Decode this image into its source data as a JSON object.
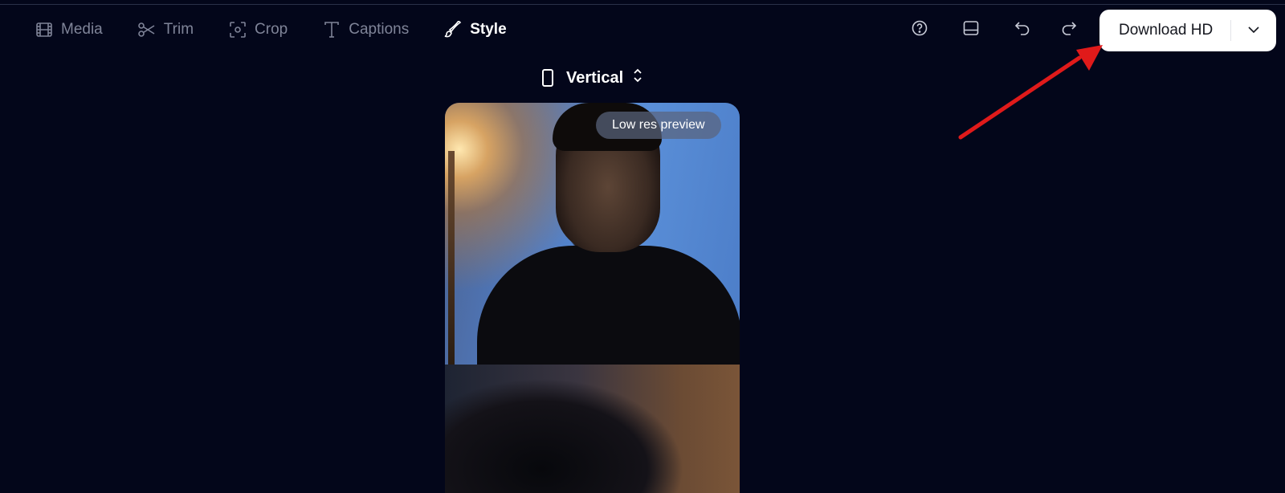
{
  "tabs": [
    {
      "label": "Media",
      "icon": "film-icon",
      "active": false
    },
    {
      "label": "Trim",
      "icon": "scissors-icon",
      "active": false
    },
    {
      "label": "Crop",
      "icon": "crop-icon",
      "active": false
    },
    {
      "label": "Captions",
      "icon": "text-icon",
      "active": false
    },
    {
      "label": "Style",
      "icon": "brush-icon",
      "active": true
    }
  ],
  "toolbar": {
    "help_icon": "help-icon",
    "layout_icon": "panel-icon",
    "undo_icon": "undo-icon",
    "redo_icon": "redo-icon"
  },
  "download": {
    "label": "Download HD",
    "caret_icon": "chevron-down-icon"
  },
  "format": {
    "label": "Vertical",
    "icon": "phone-icon",
    "toggle_icon": "updown-icon"
  },
  "preview": {
    "badge": "Low res preview"
  },
  "colors": {
    "background": "#03061a",
    "tab_inactive": "#7f8498",
    "tab_active": "#ffffff",
    "download_bg": "#ffffff",
    "annotation_arrow": "#e01a1a"
  }
}
